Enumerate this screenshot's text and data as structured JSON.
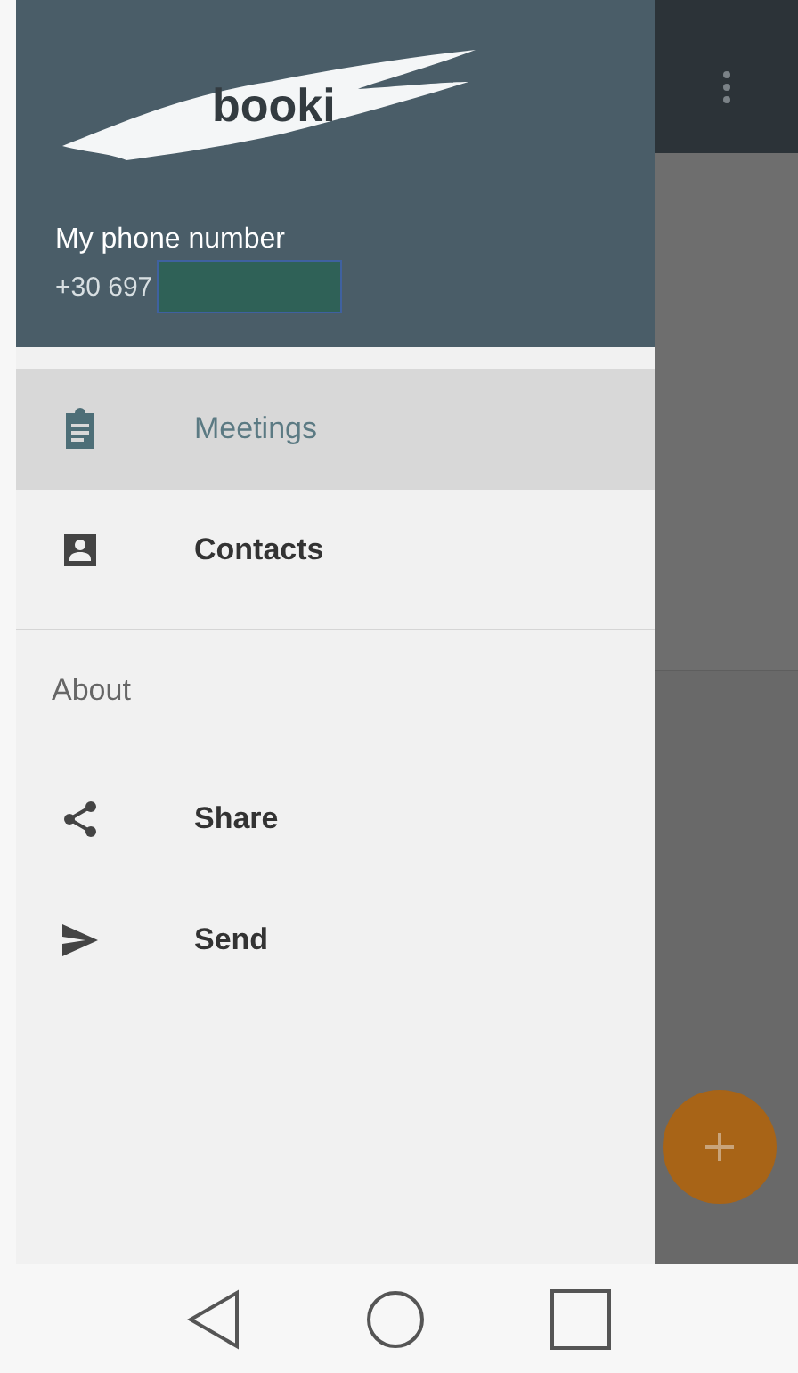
{
  "drawer": {
    "logo": "booki",
    "phone_label": "My phone number",
    "phone_number": "+30 697",
    "phone_redacted": true,
    "items": [
      {
        "kind": "clipboard",
        "label": "Meetings",
        "selected": true
      },
      {
        "kind": "contact",
        "label": "Contacts",
        "selected": false
      }
    ],
    "about": {
      "title": "About",
      "items": [
        {
          "kind": "share",
          "label": "Share",
          "selected": false
        },
        {
          "kind": "send",
          "label": "Send",
          "selected": false
        }
      ]
    }
  }
}
